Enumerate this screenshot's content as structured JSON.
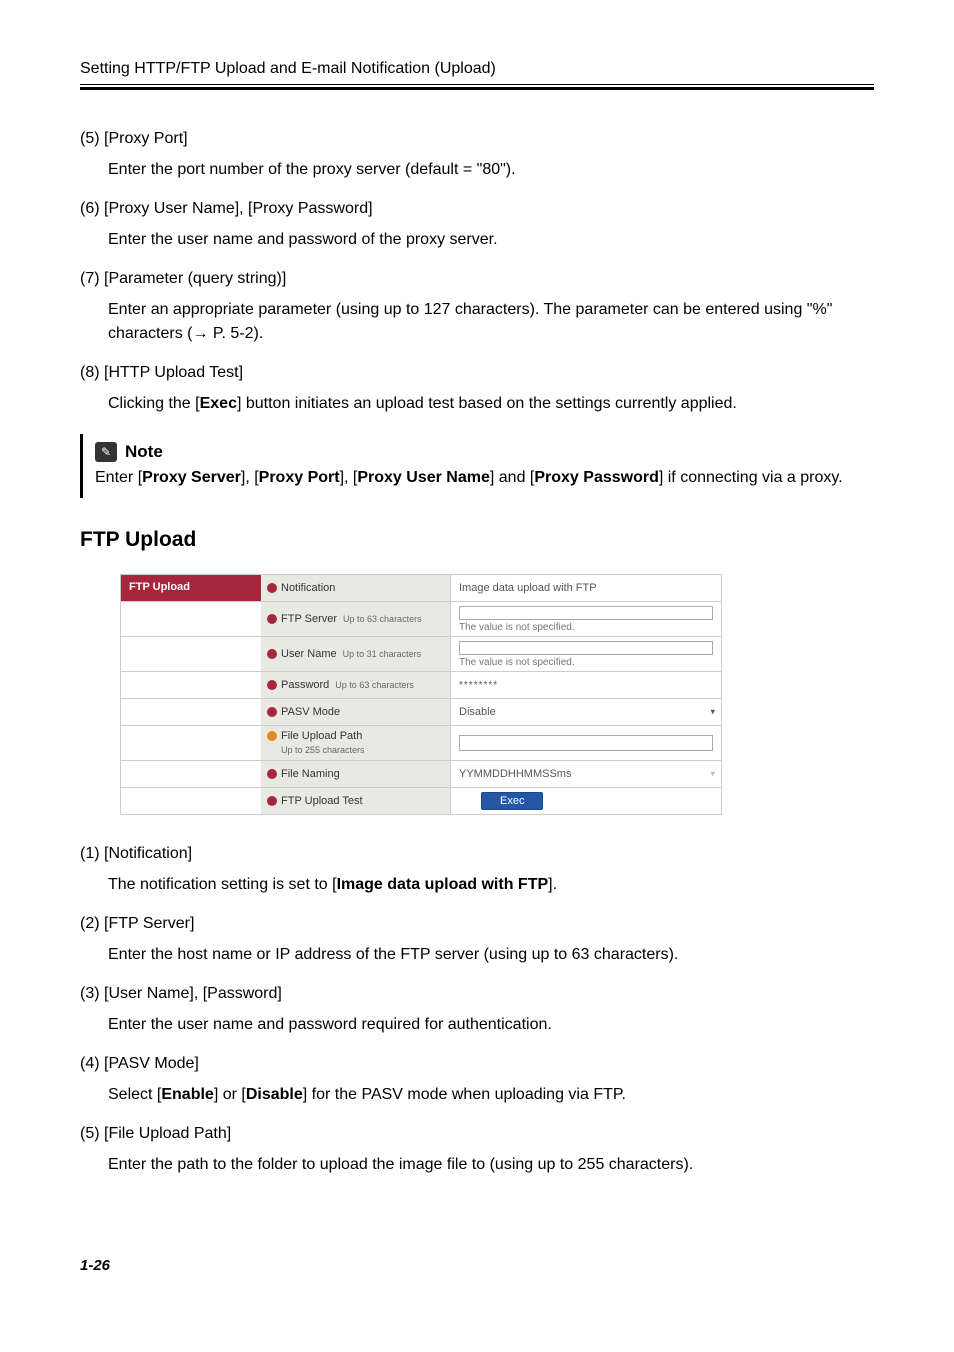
{
  "header": {
    "title": "Setting HTTP/FTP Upload and E-mail Notification (Upload)"
  },
  "items_top": [
    {
      "num": "(5)",
      "title": "[Proxy Port]",
      "body_plain": "Enter the port number of the proxy server (default = \"80\")."
    },
    {
      "num": "(6)",
      "title": "[Proxy User Name], [Proxy Password]",
      "body_plain": "Enter the user name and password of the proxy server."
    },
    {
      "num": "(7)",
      "title": "[Parameter (query string)]",
      "body_plain": "Enter an appropriate parameter (using up to 127 characters). The parameter can be entered using \"%\" characters (→ P. 5-2)."
    },
    {
      "num": "(8)",
      "title": "[HTTP Upload Test]",
      "body_pre": "Clicking the [",
      "body_bold": "Exec",
      "body_post": "] button initiates an upload test based on the settings currently applied."
    }
  ],
  "note": {
    "label": "Note",
    "pre": "Enter [",
    "b1": "Proxy Server",
    "mid1": "], [",
    "b2": "Proxy Port",
    "mid2": "], [",
    "b3": "Proxy User Name",
    "mid3": "] and [",
    "b4": "Proxy Password",
    "post": "] if connecting via a proxy."
  },
  "section_title": "FTP Upload",
  "ftp_ui": {
    "header_label": "FTP Upload",
    "rows": [
      {
        "label": "Notification",
        "dot": "red",
        "value": "Image data upload with FTP",
        "type": "text"
      },
      {
        "label": "FTP Server",
        "sub": "Up to 63 characters",
        "dot": "red",
        "msg": "The value is not specified.",
        "type": "input-msg"
      },
      {
        "label": "User Name",
        "sub": "Up to 31 characters",
        "dot": "red",
        "msg": "The value is not specified.",
        "type": "input-msg"
      },
      {
        "label": "Password",
        "sub": "Up to 63 characters",
        "dot": "red",
        "value": "********",
        "type": "text"
      },
      {
        "label": "PASV Mode",
        "dot": "red",
        "value": "Disable",
        "type": "select"
      },
      {
        "label": "File Upload Path",
        "sub": "Up to 255 characters",
        "dot": "orange",
        "value": "",
        "type": "input"
      },
      {
        "label": "File Naming",
        "dot": "red",
        "value": "YYMMDDHHMMSSms",
        "type": "select-grey"
      },
      {
        "label": "FTP Upload Test",
        "dot": "red",
        "value": "Exec",
        "type": "button"
      }
    ]
  },
  "items_bottom": [
    {
      "num": "(1)",
      "title": "[Notification]",
      "body_pre": "The notification setting is set to [",
      "body_bold": "Image data upload with FTP",
      "body_post": "]."
    },
    {
      "num": "(2)",
      "title": "[FTP Server]",
      "body_plain": "Enter the host name or IP address of the FTP server (using up to 63 characters)."
    },
    {
      "num": "(3)",
      "title": "[User Name], [Password]",
      "body_plain": "Enter the user name and password required for authentication."
    },
    {
      "num": "(4)",
      "title": "[PASV Mode]",
      "body_pre": "Select [",
      "body_bold": "Enable",
      "body_mid": "] or [",
      "body_bold2": "Disable",
      "body_post": "] for the PASV mode when uploading via FTP."
    },
    {
      "num": "(5)",
      "title": "[File Upload Path]",
      "body_plain": "Enter the path to the folder to upload the image file to (using up to 255 characters)."
    }
  ],
  "page_number": "1-26"
}
